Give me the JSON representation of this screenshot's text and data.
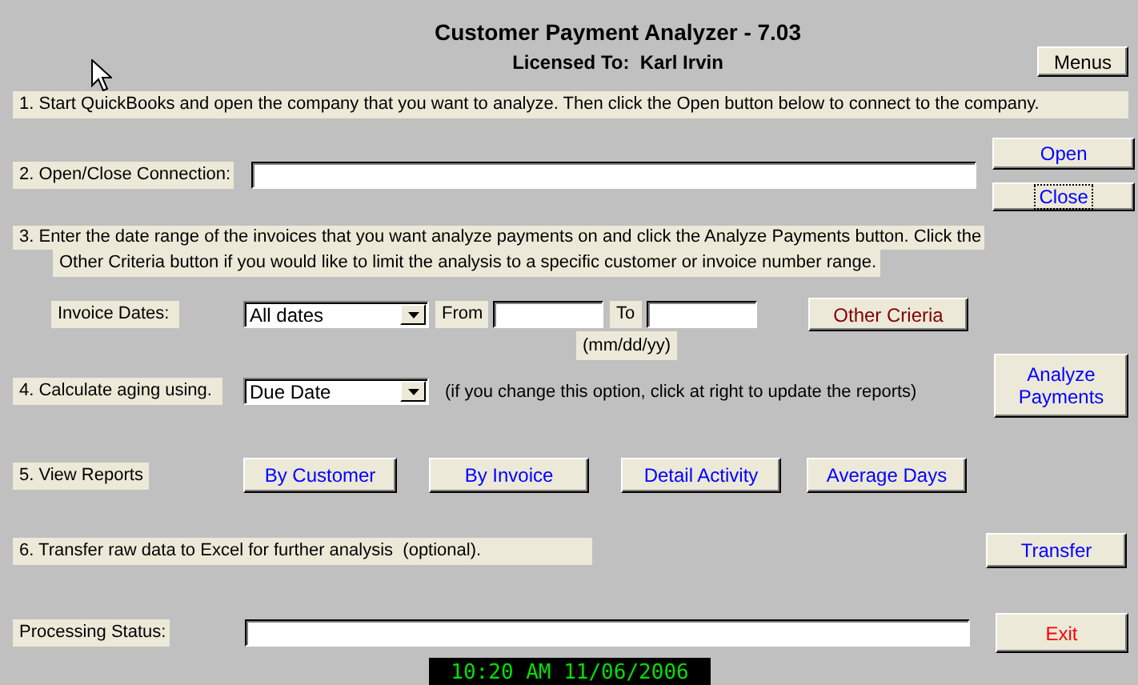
{
  "title": "Customer Payment Analyzer - 7.03",
  "license": "Licensed To:  Karl Irvin",
  "menus_button": {
    "label": "Menus",
    "color": "#000000",
    "focused": false
  },
  "step1": {
    "text": "1. Start QuickBooks and open the company that you want to analyze. Then click the Open button below to connect to the company."
  },
  "step2": {
    "label": "2. Open/Close Connection:",
    "buttons": [
      {
        "label": "Open",
        "color": "#0000ff",
        "focused": false
      },
      {
        "label": "Close",
        "color": "#0000ff",
        "focused": true
      }
    ]
  },
  "step3": {
    "lines": [
      "3. Enter the date range of the invoices that you want analyze payments on and click the Analyze Payments button. Click the",
      "Other Criteria button if you would like to limit the analysis to a specific customer or invoice number range."
    ],
    "dates_label": "Invoice Dates:",
    "range": {
      "value": "All dates"
    },
    "from_label": "From",
    "to_label": "To",
    "format_hint": "(mm/dd/yy)",
    "criteria_button": {
      "label": "Other Crieria",
      "color": "#800000",
      "focused": false
    }
  },
  "analyze_button": {
    "label": "Analyze Payments",
    "color": "#0000ff",
    "focused": false
  },
  "step4": {
    "label": "4. Calculate aging using.",
    "basis": {
      "value": "Due Date"
    },
    "note": "(if you change this option, click at right to update the reports)"
  },
  "step5": {
    "label": "5. View Reports",
    "buttons": [
      {
        "label": "By Customer",
        "color": "#0000ff",
        "focused": false
      },
      {
        "label": "By Invoice",
        "color": "#0000ff",
        "focused": false
      },
      {
        "label": "Detail Activity",
        "color": "#0000ff",
        "focused": false
      },
      {
        "label": "Average Days",
        "color": "#0000ff",
        "focused": false
      }
    ]
  },
  "step6": {
    "label": "6. Transfer raw data to Excel for further analysis  (optional).",
    "button": {
      "label": "Transfer",
      "color": "#0000ff",
      "focused": false
    }
  },
  "status": {
    "label": "Processing Status:"
  },
  "exit_button": {
    "label": "Exit",
    "color": "#ff0000",
    "focused": false
  },
  "clock": "10:20 AM 11/06/2006"
}
